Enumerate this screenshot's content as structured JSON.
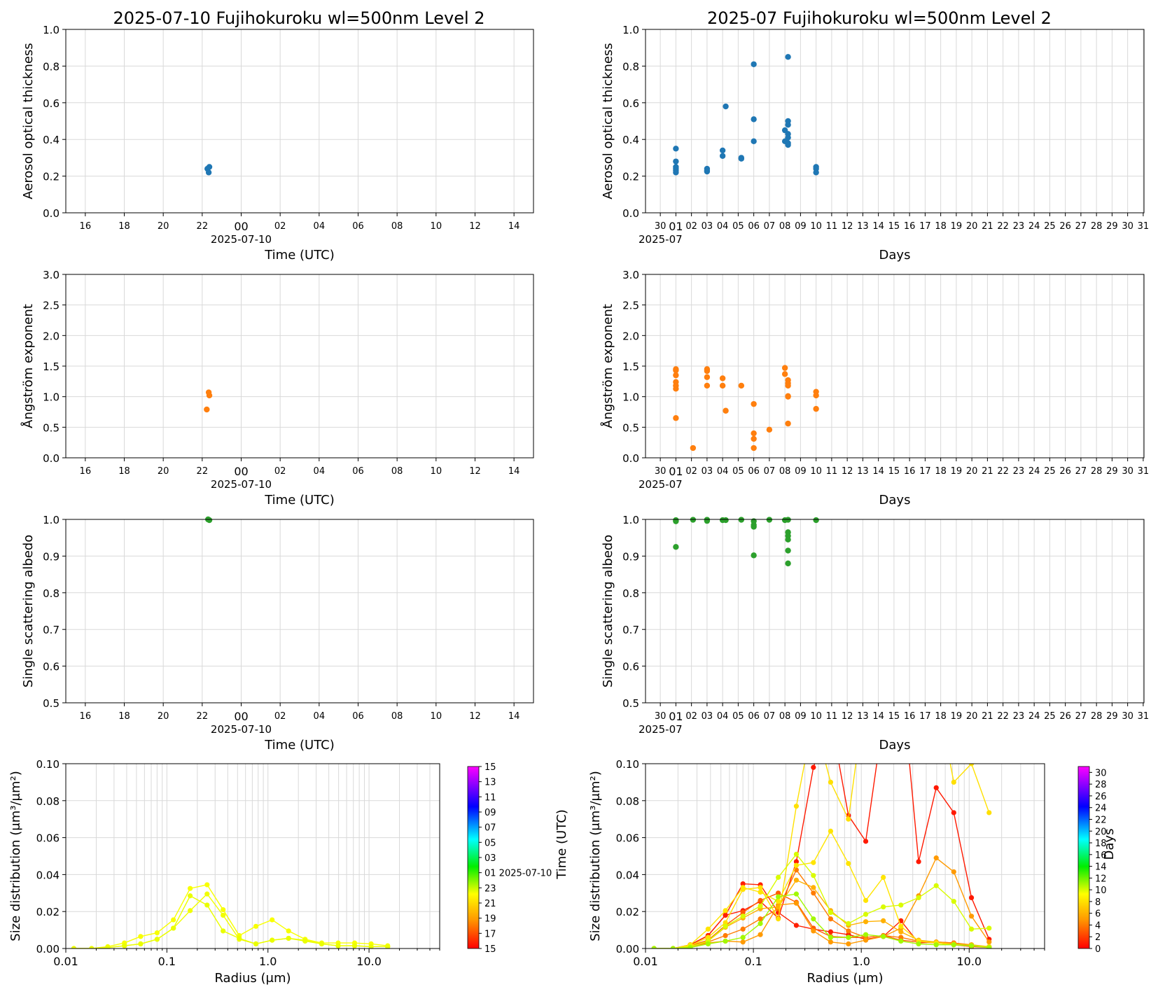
{
  "colors": {
    "aot": "#1f77b4",
    "angstrom": "#ff7f0e",
    "ssa": "#2ca02c",
    "grid": "#d9d9d9"
  },
  "chart_data": [
    {
      "id": "daily_aot",
      "type": "scatter",
      "title": "2025-07-10  Fujihokuroku  wl=500nm  Level 2",
      "xlabel": "Time (UTC)",
      "ylabel": "Aerosol optical thickness",
      "ylim": [
        0,
        1.0
      ],
      "yticks": [
        "0.0",
        "0.2",
        "0.4",
        "0.6",
        "0.8",
        "1.0"
      ],
      "xticks": [
        "16",
        "18",
        "20",
        "22",
        "00",
        "02",
        "04",
        "06",
        "08",
        "10",
        "12",
        "14"
      ],
      "x_sublabel": "2025-07-10",
      "xlim_hours": [
        15,
        39
      ],
      "grid": true,
      "points": [
        {
          "time": "2025-07-09T22:16",
          "value": 0.24
        },
        {
          "time": "2025-07-09T22:20",
          "value": 0.22
        },
        {
          "time": "2025-07-09T22:22",
          "value": 0.25
        }
      ]
    },
    {
      "id": "daily_angstrom",
      "type": "scatter",
      "xlabel": "Time (UTC)",
      "ylabel": "Ångström exponent",
      "ylim": [
        0,
        3.0
      ],
      "yticks": [
        "0.0",
        "0.5",
        "1.0",
        "1.5",
        "2.0",
        "2.5",
        "3.0"
      ],
      "xticks": [
        "16",
        "18",
        "20",
        "22",
        "00",
        "02",
        "04",
        "06",
        "08",
        "10",
        "12",
        "14"
      ],
      "x_sublabel": "2025-07-10",
      "grid": true,
      "points": [
        {
          "time": "2025-07-09T22:14",
          "value": 0.79
        },
        {
          "time": "2025-07-09T22:20",
          "value": 1.07
        },
        {
          "time": "2025-07-09T22:22",
          "value": 1.02
        }
      ]
    },
    {
      "id": "daily_ssa",
      "type": "scatter",
      "xlabel": "Time (UTC)",
      "ylabel": "Single scattering albedo",
      "ylim": [
        0.5,
        1.0
      ],
      "yticks": [
        "0.5",
        "0.6",
        "0.7",
        "0.8",
        "0.9",
        "1.0"
      ],
      "xticks": [
        "16",
        "18",
        "20",
        "22",
        "00",
        "02",
        "04",
        "06",
        "08",
        "10",
        "12",
        "14"
      ],
      "x_sublabel": "2025-07-10",
      "grid": true,
      "points": [
        {
          "time": "2025-07-09T22:18",
          "value": 1.0
        },
        {
          "time": "2025-07-09T22:22",
          "value": 0.998
        }
      ]
    },
    {
      "id": "daily_size",
      "type": "line",
      "xlabel": "Radius (μm)",
      "ylabel": "Size distribution (μm³/μm²)",
      "xscale": "log",
      "xlim": [
        0.01,
        50
      ],
      "ylim": [
        0,
        0.1
      ],
      "xticks": [
        "0.01",
        "0.1",
        "1.0",
        "10.0"
      ],
      "yticks": [
        "0.00",
        "0.02",
        "0.04",
        "0.06",
        "0.08",
        "0.10"
      ],
      "radius": [
        0.012,
        0.018,
        0.026,
        0.038,
        0.055,
        0.08,
        0.116,
        0.17,
        0.25,
        0.36,
        0.52,
        0.76,
        1.1,
        1.6,
        2.33,
        3.4,
        4.95,
        7.2,
        10.5,
        15.3
      ],
      "series": [
        {
          "color_value": 22.3,
          "values": [
            0.0,
            0.0,
            0.001,
            0.003,
            0.0065,
            0.0085,
            0.0155,
            0.0325,
            0.0345,
            0.021,
            0.007,
            0.012,
            0.0155,
            0.0095,
            0.005,
            0.003,
            0.003,
            0.003,
            0.0025,
            0.0015
          ]
        },
        {
          "color_value": 22.4,
          "values": [
            0.0,
            0.0,
            0.0005,
            0.0015,
            0.0025,
            0.005,
            0.011,
            0.0205,
            0.0295,
            0.018,
            0.005,
            0.0025,
            0.0045,
            0.0055,
            0.0045,
            0.0025,
            0.0015,
            0.0015,
            0.001,
            0.001
          ]
        },
        {
          "color_value": 22.5,
          "values": [
            0.0,
            0.0,
            0.0005,
            0.0015,
            0.0025,
            0.005,
            0.011,
            0.0285,
            0.0235,
            0.0095,
            0.0055,
            0.0025,
            0.0045,
            0.0055,
            0.004,
            0.0025,
            0.0015,
            0.0015,
            0.001,
            0.001
          ]
        }
      ],
      "colorbar": {
        "label": "Time (UTC)",
        "ticks": [
          "15",
          "17",
          "19",
          "21",
          "23",
          "01 2025-07-10",
          "03",
          "05",
          "07",
          "09",
          "11",
          "13",
          "15"
        ]
      }
    },
    {
      "id": "monthly_aot",
      "type": "scatter",
      "title": "2025-07  Fujihokuroku  wl=500nm  Level 2",
      "xlabel": "Days",
      "ylabel": "Aerosol optical thickness",
      "ylim": [
        0,
        1.0
      ],
      "yticks": [
        "0.0",
        "0.2",
        "0.4",
        "0.6",
        "0.8",
        "1.0"
      ],
      "xticks": [
        "30",
        "01",
        "02",
        "03",
        "04",
        "05",
        "06",
        "07",
        "08",
        "09",
        "10",
        "11",
        "12",
        "13",
        "14",
        "15",
        "16",
        "17",
        "18",
        "19",
        "20",
        "21",
        "22",
        "23",
        "24",
        "25",
        "26",
        "27",
        "28",
        "29",
        "30",
        "31"
      ],
      "x_sublabel": "2025-07",
      "grid": true,
      "points": [
        {
          "day": 1.0,
          "value": 0.35
        },
        {
          "day": 1.0,
          "value": 0.28
        },
        {
          "day": 1.0,
          "value": 0.25
        },
        {
          "day": 1.0,
          "value": 0.24
        },
        {
          "day": 1.0,
          "value": 0.23
        },
        {
          "day": 1.0,
          "value": 0.22
        },
        {
          "day": 3.0,
          "value": 0.24
        },
        {
          "day": 3.0,
          "value": 0.23
        },
        {
          "day": 3.0,
          "value": 0.225
        },
        {
          "day": 4.0,
          "value": 0.34
        },
        {
          "day": 4.0,
          "value": 0.31
        },
        {
          "day": 4.2,
          "value": 0.58
        },
        {
          "day": 5.2,
          "value": 0.3
        },
        {
          "day": 5.2,
          "value": 0.295
        },
        {
          "day": 6.0,
          "value": 0.81
        },
        {
          "day": 6.0,
          "value": 0.51
        },
        {
          "day": 6.0,
          "value": 0.39
        },
        {
          "day": 8.0,
          "value": 0.45
        },
        {
          "day": 8.0,
          "value": 0.39
        },
        {
          "day": 8.2,
          "value": 0.85
        },
        {
          "day": 8.2,
          "value": 0.5
        },
        {
          "day": 8.2,
          "value": 0.48
        },
        {
          "day": 8.2,
          "value": 0.43
        },
        {
          "day": 8.2,
          "value": 0.41
        },
        {
          "day": 8.2,
          "value": 0.38
        },
        {
          "day": 8.2,
          "value": 0.37
        },
        {
          "day": 10.0,
          "value": 0.25
        },
        {
          "day": 10.0,
          "value": 0.24
        },
        {
          "day": 10.0,
          "value": 0.22
        }
      ]
    },
    {
      "id": "monthly_angstrom",
      "type": "scatter",
      "xlabel": "Days",
      "ylabel": "Ångström exponent",
      "ylim": [
        0,
        3.0
      ],
      "yticks": [
        "0.0",
        "0.5",
        "1.0",
        "1.5",
        "2.0",
        "2.5",
        "3.0"
      ],
      "xticks": [
        "30",
        "01",
        "02",
        "03",
        "04",
        "05",
        "06",
        "07",
        "08",
        "09",
        "10",
        "11",
        "12",
        "13",
        "14",
        "15",
        "16",
        "17",
        "18",
        "19",
        "20",
        "21",
        "22",
        "23",
        "24",
        "25",
        "26",
        "27",
        "28",
        "29",
        "30",
        "31"
      ],
      "x_sublabel": "2025-07",
      "grid": true,
      "points": [
        {
          "day": 1.0,
          "value": 1.45
        },
        {
          "day": 1.0,
          "value": 1.43
        },
        {
          "day": 1.0,
          "value": 1.35
        },
        {
          "day": 1.0,
          "value": 1.24
        },
        {
          "day": 1.0,
          "value": 1.18
        },
        {
          "day": 1.0,
          "value": 1.13
        },
        {
          "day": 1.0,
          "value": 0.65
        },
        {
          "day": 2.1,
          "value": 0.16
        },
        {
          "day": 3.0,
          "value": 1.45
        },
        {
          "day": 3.0,
          "value": 1.42
        },
        {
          "day": 3.0,
          "value": 1.32
        },
        {
          "day": 3.0,
          "value": 1.18
        },
        {
          "day": 4.0,
          "value": 1.3
        },
        {
          "day": 4.0,
          "value": 1.18
        },
        {
          "day": 4.2,
          "value": 0.77
        },
        {
          "day": 5.2,
          "value": 1.18
        },
        {
          "day": 6.0,
          "value": 0.88
        },
        {
          "day": 6.0,
          "value": 0.4
        },
        {
          "day": 6.0,
          "value": 0.31
        },
        {
          "day": 6.0,
          "value": 0.16
        },
        {
          "day": 7.0,
          "value": 0.46
        },
        {
          "day": 8.0,
          "value": 1.47
        },
        {
          "day": 8.0,
          "value": 1.37
        },
        {
          "day": 8.2,
          "value": 1.27
        },
        {
          "day": 8.2,
          "value": 1.22
        },
        {
          "day": 8.2,
          "value": 1.18
        },
        {
          "day": 8.2,
          "value": 1.01
        },
        {
          "day": 8.2,
          "value": 1.0
        },
        {
          "day": 8.2,
          "value": 0.56
        },
        {
          "day": 10.0,
          "value": 1.08
        },
        {
          "day": 10.0,
          "value": 1.02
        },
        {
          "day": 10.0,
          "value": 0.8
        }
      ]
    },
    {
      "id": "monthly_ssa",
      "type": "scatter",
      "xlabel": "Days",
      "ylabel": "Single scattering albedo",
      "ylim": [
        0.5,
        1.0
      ],
      "yticks": [
        "0.5",
        "0.6",
        "0.7",
        "0.8",
        "0.9",
        "1.0"
      ],
      "xticks": [
        "30",
        "01",
        "02",
        "03",
        "04",
        "05",
        "06",
        "07",
        "08",
        "09",
        "10",
        "11",
        "12",
        "13",
        "14",
        "15",
        "16",
        "17",
        "18",
        "19",
        "20",
        "21",
        "22",
        "23",
        "24",
        "25",
        "26",
        "27",
        "28",
        "29",
        "30",
        "31"
      ],
      "x_sublabel": "2025-07",
      "grid": true,
      "points": [
        {
          "day": 1.0,
          "value": 0.998
        },
        {
          "day": 1.0,
          "value": 0.995
        },
        {
          "day": 1.0,
          "value": 0.925
        },
        {
          "day": 2.1,
          "value": 0.999
        },
        {
          "day": 3.0,
          "value": 0.999
        },
        {
          "day": 3.0,
          "value": 0.996
        },
        {
          "day": 4.0,
          "value": 0.998
        },
        {
          "day": 4.2,
          "value": 0.998
        },
        {
          "day": 5.2,
          "value": 0.999
        },
        {
          "day": 6.0,
          "value": 0.995
        },
        {
          "day": 6.0,
          "value": 0.985
        },
        {
          "day": 6.0,
          "value": 0.98
        },
        {
          "day": 6.0,
          "value": 0.902
        },
        {
          "day": 7.0,
          "value": 0.999
        },
        {
          "day": 8.0,
          "value": 0.998
        },
        {
          "day": 8.2,
          "value": 0.999
        },
        {
          "day": 8.2,
          "value": 0.965
        },
        {
          "day": 8.2,
          "value": 0.955
        },
        {
          "day": 8.2,
          "value": 0.945
        },
        {
          "day": 8.2,
          "value": 0.915
        },
        {
          "day": 8.2,
          "value": 0.88
        },
        {
          "day": 10.0,
          "value": 0.998
        }
      ]
    },
    {
      "id": "monthly_size",
      "type": "line",
      "xlabel": "Radius (μm)",
      "ylabel": "Size distribution (μm³/μm²)",
      "xscale": "log",
      "xlim": [
        0.01,
        50
      ],
      "ylim": [
        0,
        0.1
      ],
      "xticks": [
        "0.01",
        "0.1",
        "1.0",
        "10.0"
      ],
      "yticks": [
        "0.00",
        "0.02",
        "0.04",
        "0.06",
        "0.08",
        "0.10"
      ],
      "radius": [
        0.012,
        0.018,
        0.026,
        0.038,
        0.055,
        0.08,
        0.116,
        0.17,
        0.25,
        0.36,
        0.52,
        0.76,
        1.1,
        1.6,
        2.33,
        3.4,
        4.95,
        7.2,
        10.5,
        15.3
      ],
      "series": [
        {
          "day": 0.8,
          "values": [
            0.0,
            0.0,
            0.002,
            0.007,
            0.018,
            0.0205,
            0.0255,
            0.0165,
            0.047,
            0.098,
            0.125,
            0.072,
            0.058,
            0.125,
            0.15,
            0.047,
            0.087,
            0.0735,
            0.0275,
            0.005
          ]
        },
        {
          "day": 1.0,
          "values": [
            0.0,
            0.0,
            0.002,
            0.007,
            0.018,
            0.035,
            0.0345,
            0.0195,
            0.0125,
            0.0105,
            0.009,
            0.0075,
            0.005,
            0.0065,
            0.015,
            0.003,
            0.0035,
            0.003,
            0.0015,
            0.001
          ]
        },
        {
          "day": 3.0,
          "values": [
            0.0,
            0.0,
            0.0015,
            0.0045,
            0.0125,
            0.0195,
            0.026,
            0.03,
            0.025,
            0.011,
            0.0065,
            0.006,
            0.006,
            0.007,
            0.0045,
            0.0035,
            0.003,
            0.002,
            0.001,
            0.0005
          ]
        },
        {
          "day": 4.0,
          "values": [
            0.0,
            0.0,
            0.001,
            0.0035,
            0.007,
            0.0105,
            0.016,
            0.0215,
            0.0425,
            0.03,
            0.016,
            0.0095,
            0.006,
            0.007,
            0.006,
            0.004,
            0.0035,
            0.003,
            0.002,
            0.0005
          ]
        },
        {
          "day": 5.0,
          "values": [
            0.0,
            0.0,
            0.0005,
            0.003,
            0.004,
            0.0035,
            0.0075,
            0.0235,
            0.0245,
            0.0095,
            0.0035,
            0.0025,
            0.0045,
            0.0065,
            0.011,
            0.0285,
            0.049,
            0.0415,
            0.0175,
            0.0035
          ]
        },
        {
          "day": 6.0,
          "values": [
            0.0,
            0.0,
            0.001,
            0.004,
            0.0115,
            0.0165,
            0.0215,
            0.0225,
            0.037,
            0.033,
            0.0205,
            0.0125,
            0.0145,
            0.015,
            0.009,
            0.0045,
            0.0035,
            0.0025,
            0.002,
            0.001
          ]
        },
        {
          "day": 8.0,
          "values": [
            0.0,
            0.0,
            0.0015,
            0.006,
            0.014,
            0.032,
            0.033,
            0.016,
            0.077,
            0.125,
            0.09,
            0.07,
            0.14,
            0.12,
            0.125,
            0.12,
            0.14,
            0.09,
            0.1,
            0.0735
          ]
        },
        {
          "day": 8.2,
          "values": [
            0.0,
            0.0,
            0.002,
            0.0105,
            0.0205,
            0.033,
            0.0305,
            0.0255,
            0.045,
            0.0465,
            0.0635,
            0.046,
            0.026,
            0.0385,
            0.012,
            0.004,
            0.003,
            0.002,
            0.0015,
            0.001
          ]
        },
        {
          "day": 10.0,
          "values": [
            0.0,
            0.0,
            0.001,
            0.004,
            0.012,
            0.0175,
            0.023,
            0.0385,
            0.051,
            0.0395,
            0.0195,
            0.0135,
            0.0185,
            0.0225,
            0.0235,
            0.0275,
            0.034,
            0.0255,
            0.0105,
            0.011
          ]
        },
        {
          "day": 11.0,
          "values": [
            0.0,
            0.0,
            0.0005,
            0.0025,
            0.004,
            0.006,
            0.0135,
            0.028,
            0.0295,
            0.016,
            0.006,
            0.006,
            0.0075,
            0.0065,
            0.004,
            0.0025,
            0.002,
            0.002,
            0.0015,
            0.0005
          ]
        }
      ],
      "colorbar": {
        "label": "Days",
        "ticks": [
          "0",
          "2",
          "4",
          "6",
          "8",
          "10",
          "12",
          "14",
          "16",
          "18",
          "20",
          "22",
          "24",
          "26",
          "28",
          "30"
        ]
      }
    }
  ]
}
